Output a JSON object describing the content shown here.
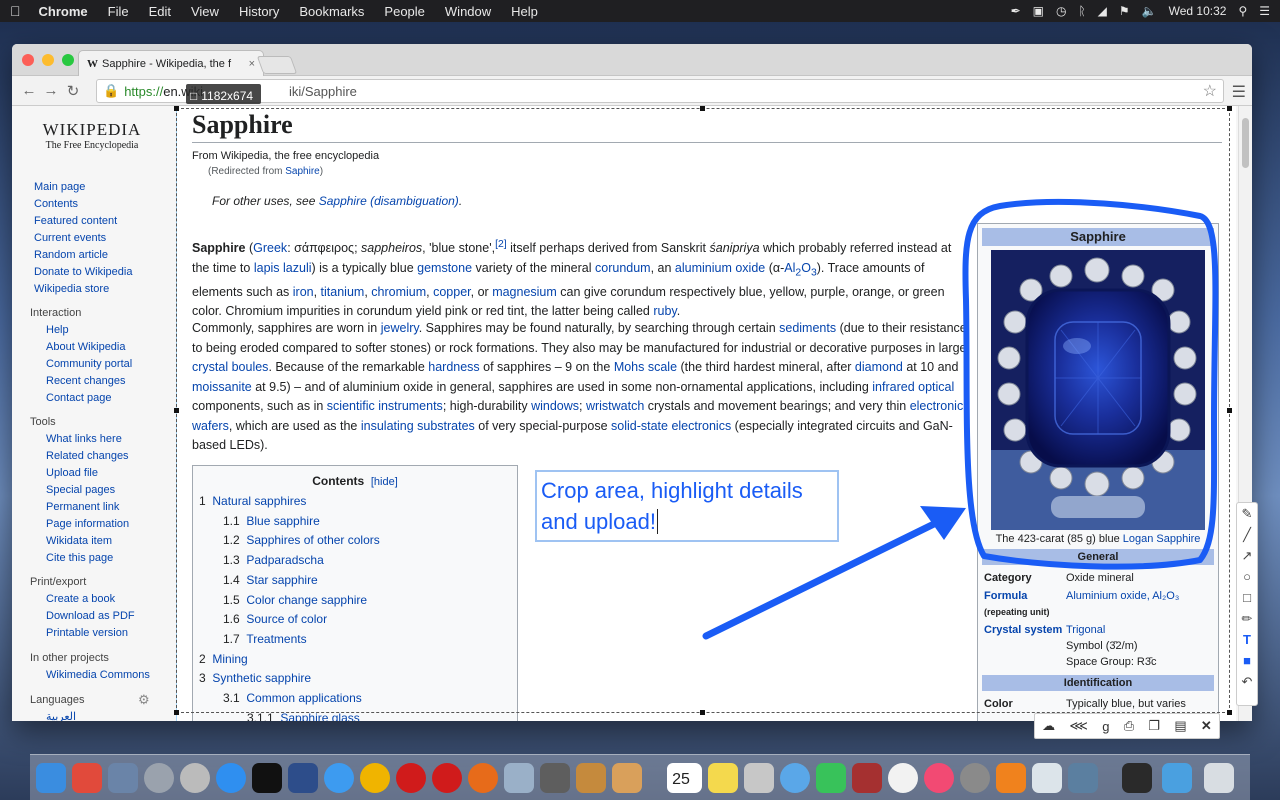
{
  "menubar": {
    "apple": "",
    "app": "Chrome",
    "items": [
      "File",
      "Edit",
      "View",
      "History",
      "Bookmarks",
      "People",
      "Window",
      "Help"
    ],
    "clock": "Wed 10:32"
  },
  "browser": {
    "tab_title": "Sapphire - Wikipedia, the f",
    "url_scheme": "https://",
    "url_host_prefix": "en.wiki",
    "url_path": "iki/Sapphire"
  },
  "selection": {
    "dimensions": "1182x674"
  },
  "sidebar": {
    "logo_title": "WIKIPEDIA",
    "logo_sub": "The Free Encyclopedia",
    "main": [
      "Main page",
      "Contents",
      "Featured content",
      "Current events",
      "Random article",
      "Donate to Wikipedia",
      "Wikipedia store"
    ],
    "interaction_heading": "Interaction",
    "interaction": [
      "Help",
      "About Wikipedia",
      "Community portal",
      "Recent changes",
      "Contact page"
    ],
    "tools_heading": "Tools",
    "tools": [
      "What links here",
      "Related changes",
      "Upload file",
      "Special pages",
      "Permanent link",
      "Page information",
      "Wikidata item",
      "Cite this page"
    ],
    "print_heading": "Print/export",
    "print": [
      "Create a book",
      "Download as PDF",
      "Printable version"
    ],
    "other_heading": "In other projects",
    "other": [
      "Wikimedia Commons"
    ],
    "languages_heading": "Languages",
    "languages": [
      "العربية"
    ]
  },
  "article": {
    "title": "Sapphire",
    "from": "From Wikipedia, the free encyclopedia",
    "redirect_prefix": "(Redirected from ",
    "redirect_link": "Saphire",
    "redirect_suffix": ")",
    "hatnote_prefix": "For other uses, see ",
    "hatnote_link": "Sapphire (disambiguation)",
    "hatnote_suffix": "."
  },
  "toc": {
    "title": "Contents",
    "hide": "[hide]",
    "items": [
      {
        "num": "1",
        "label": "Natural sapphires",
        "level": 1
      },
      {
        "num": "1.1",
        "label": "Blue sapphire",
        "level": 2
      },
      {
        "num": "1.2",
        "label": "Sapphires of other colors",
        "level": 2
      },
      {
        "num": "1.3",
        "label": "Padparadscha",
        "level": 2
      },
      {
        "num": "1.4",
        "label": "Star sapphire",
        "level": 2
      },
      {
        "num": "1.5",
        "label": "Color change sapphire",
        "level": 2
      },
      {
        "num": "1.6",
        "label": "Source of color",
        "level": 2
      },
      {
        "num": "1.7",
        "label": "Treatments",
        "level": 2
      },
      {
        "num": "2",
        "label": "Mining",
        "level": 1
      },
      {
        "num": "3",
        "label": "Synthetic sapphire",
        "level": 1
      },
      {
        "num": "3.1",
        "label": "Common applications",
        "level": 2
      },
      {
        "num": "3.1.1",
        "label": "Sapphire glass",
        "level": 3
      }
    ]
  },
  "infobox": {
    "title": "Sapphire",
    "caption_prefix": "The 423-carat (85 g) blue ",
    "caption_link": "Logan Sapphire",
    "general": "General",
    "category_k": "Category",
    "category_v": "Oxide mineral",
    "formula_k": "Formula",
    "formula_sub": "(repeating unit)",
    "formula_v": "Aluminium oxide, Al₂O₃",
    "crystal_k": "Crystal system",
    "crystal_v1": "Trigonal",
    "crystal_v2": "Symbol (3̄2/m)",
    "crystal_v3": "Space Group: R3̄c",
    "identification": "Identification",
    "color_k": "Color",
    "color_v": "Typically blue, but varies"
  },
  "annotation": {
    "text_line1": "Crop area, highlight details",
    "text_line2": "and upload!"
  },
  "colors": {
    "annotation_blue": "#1a5cf5",
    "link": "#0645ad",
    "infobox_header": "#a8bde6"
  }
}
